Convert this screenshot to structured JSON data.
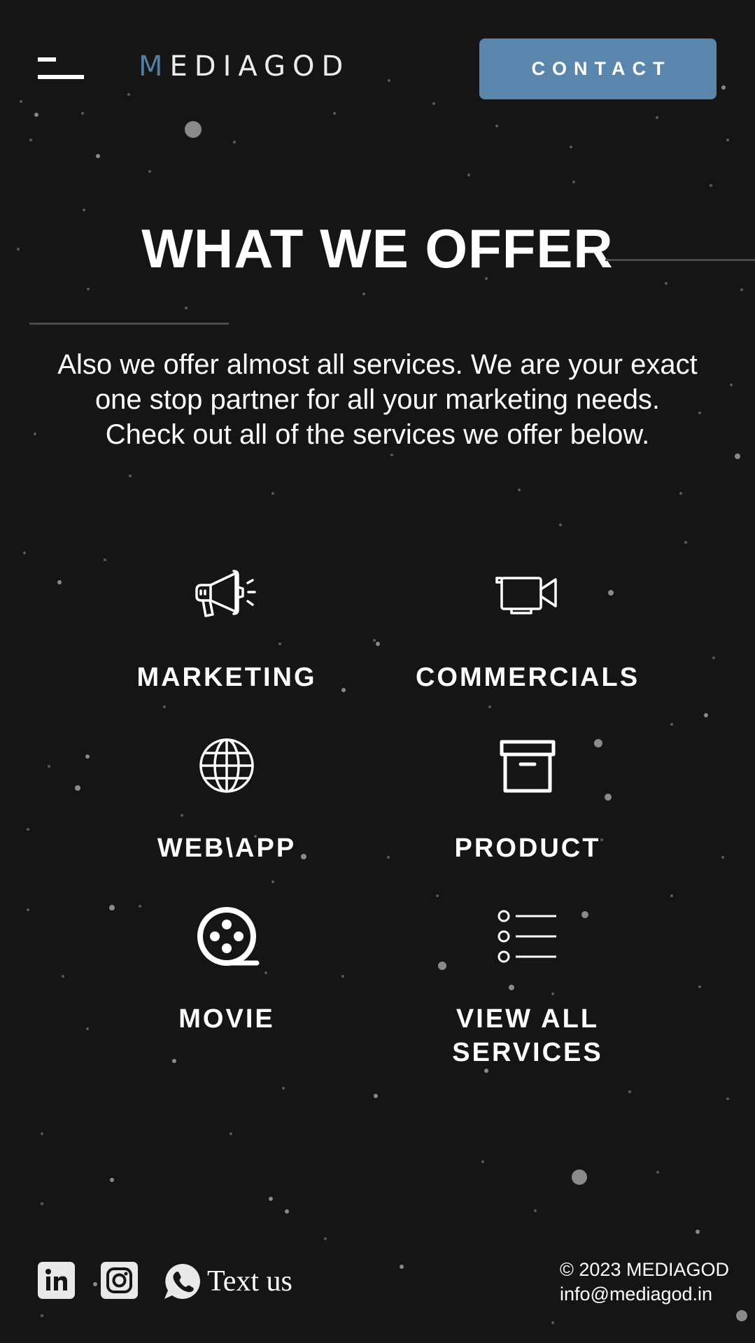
{
  "header": {
    "logo_first": "M",
    "logo_rest": "EDIAGOD",
    "contact_label": "CONTACT",
    "accent_color": "#5a86ad"
  },
  "section": {
    "title": "WHAT WE OFFER",
    "intro_lines": [
      "Also we offer almost all services. We are your exact",
      "one stop partner for all your marketing needs.",
      "Check out all of the services we offer below."
    ]
  },
  "services": [
    {
      "label": "MARKETING",
      "icon": "megaphone-icon"
    },
    {
      "label": "COMMERCIALS",
      "icon": "video-camera-icon"
    },
    {
      "label": "WEB\\APP",
      "icon": "globe-icon"
    },
    {
      "label": "PRODUCT",
      "icon": "archive-box-icon"
    },
    {
      "label": "MOVIE",
      "icon": "film-reel-icon"
    },
    {
      "label_lines": [
        "VIEW ALL",
        "SERVICES"
      ],
      "icon": "list-icon"
    }
  ],
  "footer": {
    "social": [
      {
        "icon": "linkedin-icon"
      },
      {
        "icon": "instagram-icon"
      }
    ],
    "text_us": {
      "icon": "whatsapp-icon",
      "label": "Text us"
    },
    "copyright": "© 2023 MEDIAGOD",
    "email": "info@mediagod.in"
  }
}
